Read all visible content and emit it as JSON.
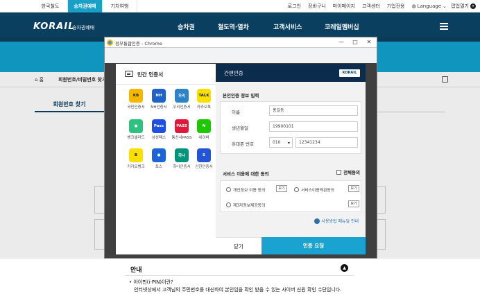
{
  "topbar": {
    "tabs": [
      "한국철도",
      "승차권예매",
      "기차여행"
    ],
    "links": [
      "로그인",
      "장바구니",
      "마이페이지",
      "고객센터",
      "기업전용"
    ],
    "language": "Language",
    "app_toggle": "팝업열기"
  },
  "nav": {
    "logo": "KORAIL",
    "logo_sub": "승차권예매",
    "items": [
      "승차권",
      "철도역·열차",
      "고객서비스",
      "코레일멤버십"
    ]
  },
  "breadcrumb": {
    "home": "홈",
    "current": "회원번호/비밀번호 찾기"
  },
  "page": {
    "tab": "회원번호 찾기"
  },
  "info": {
    "title": "안내",
    "question": "• 아이핀(i-PIN)이란?",
    "answer": "인터넷상에서 고객님의 주민번호를 대신하여 본인임을 확인 받을 수 있는 사이버 신원 확인 수단입니다."
  },
  "chrome": {
    "title": "정부통합인증 - Chrome",
    "min": "—",
    "max": "□",
    "close": "✕"
  },
  "auth": {
    "left_title": "민간 인증서",
    "providers": [
      {
        "name": "국민인증서",
        "tile": "KB",
        "color": "#f5b800"
      },
      {
        "name": "NH인증서",
        "tile": "NH",
        "color": "#1e63c8"
      },
      {
        "name": "우리인증서",
        "tile": "우리",
        "color": "#2b84c6"
      },
      {
        "name": "카카오톡",
        "tile": "TALK",
        "color": "#f9e000"
      },
      {
        "name": "뱅크샐러드",
        "tile": "●",
        "color": "#2ec27e"
      },
      {
        "name": "삼성패스",
        "tile": "Pass",
        "color": "#1e50e6"
      },
      {
        "name": "통신사PASS",
        "tile": "PASS",
        "color": "#e0193a"
      },
      {
        "name": "네이버",
        "tile": "N",
        "color": "#1ec800"
      },
      {
        "name": "카카오뱅크",
        "tile": "B",
        "color": "#f9e000"
      },
      {
        "name": "토스",
        "tile": "●",
        "color": "#1b64da"
      },
      {
        "name": "하나인증서",
        "tile": "하나",
        "color": "#00947a"
      },
      {
        "name": "신한인증서",
        "tile": "S",
        "color": "#2354d6"
      }
    ],
    "right_title": "간편인증",
    "right_logo": "KORAIL",
    "section_title": "본인인증 정보 입력",
    "fields": {
      "name_label": "이름",
      "name_value": "홍길동",
      "birth_label": "생년월일",
      "birth_value": "19900101",
      "phone_label": "휴대폰 번호",
      "phone_prefix": "010",
      "phone_value": "12341234"
    },
    "consent_title": "서비스 이용에 대한 동의",
    "agree_all": "전체동의",
    "consents": [
      "개인정보 이용 동의",
      "서비스이용약관동의",
      "제3자정보제공동의"
    ],
    "view_label": "보기",
    "guide_link": "사용방법 매뉴얼 안내",
    "close_btn": "닫기",
    "request_btn": "인증 요청"
  }
}
